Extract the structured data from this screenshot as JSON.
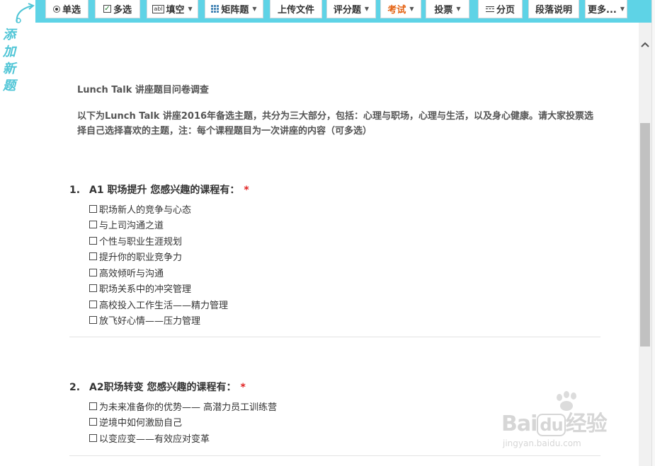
{
  "side_label": {
    "text": "添加新题"
  },
  "toolbar": {
    "buttons": [
      {
        "label": "单选",
        "icon": "radio-icon"
      },
      {
        "label": "多选",
        "icon": "checkbox-icon"
      },
      {
        "label": "填空",
        "icon": "fill-blank-icon",
        "dropdown": true
      },
      {
        "label": "矩阵题",
        "icon": "matrix-icon",
        "dropdown": true
      },
      {
        "label": "上传文件"
      },
      {
        "label": "评分题",
        "dropdown": true
      },
      {
        "label": "考试",
        "dropdown": true,
        "accent": "#e4600f"
      },
      {
        "label": "投票",
        "dropdown": true
      },
      {
        "label": "分页",
        "icon": "page-break-icon"
      },
      {
        "label": "段落说明"
      },
      {
        "label": "更多...",
        "dropdown": true
      }
    ],
    "fill_icon_text": "abl"
  },
  "survey": {
    "title": "Lunch Talk 讲座题目问卷调查",
    "description": "以下为Lunch Talk 讲座2016年备选主题，共分为三大部分，包括：心理与职场，心理与生活，以及身心健康。请大家投票选择自己选择喜欢的主题，注：每个课程题目为一次讲座的内容（可多选）"
  },
  "questions": [
    {
      "number": "1.",
      "title": "A1 职场提升 您感兴趣的课程有：",
      "required_mark": "*",
      "options": [
        "职场新人的竞争与心态",
        "与上司沟通之道",
        "个性与职业生涯规划",
        "提升你的职业竞争力",
        "高效倾听与沟通",
        "职场关系中的冲突管理",
        "高校投入工作生活——精力管理",
        "放飞好心情——压力管理"
      ]
    },
    {
      "number": "2.",
      "title": "A2职场转变 您感兴趣的课程有：",
      "required_mark": "*",
      "options": [
        "为未来准备你的优势—— 高潜力员工训练营",
        "逆境中如何激励自己",
        "以变应变——有效应对变革"
      ]
    }
  ],
  "watermark": {
    "logo_a": "Bai",
    "logo_b": "du",
    "logo_c": "经验",
    "url": "jingyan.baidu.com"
  },
  "colors": {
    "toolbar_bg": "#5ed3e6",
    "side_text": "#4fc5d6",
    "required": "#e02020",
    "accent": "#e4600f"
  }
}
